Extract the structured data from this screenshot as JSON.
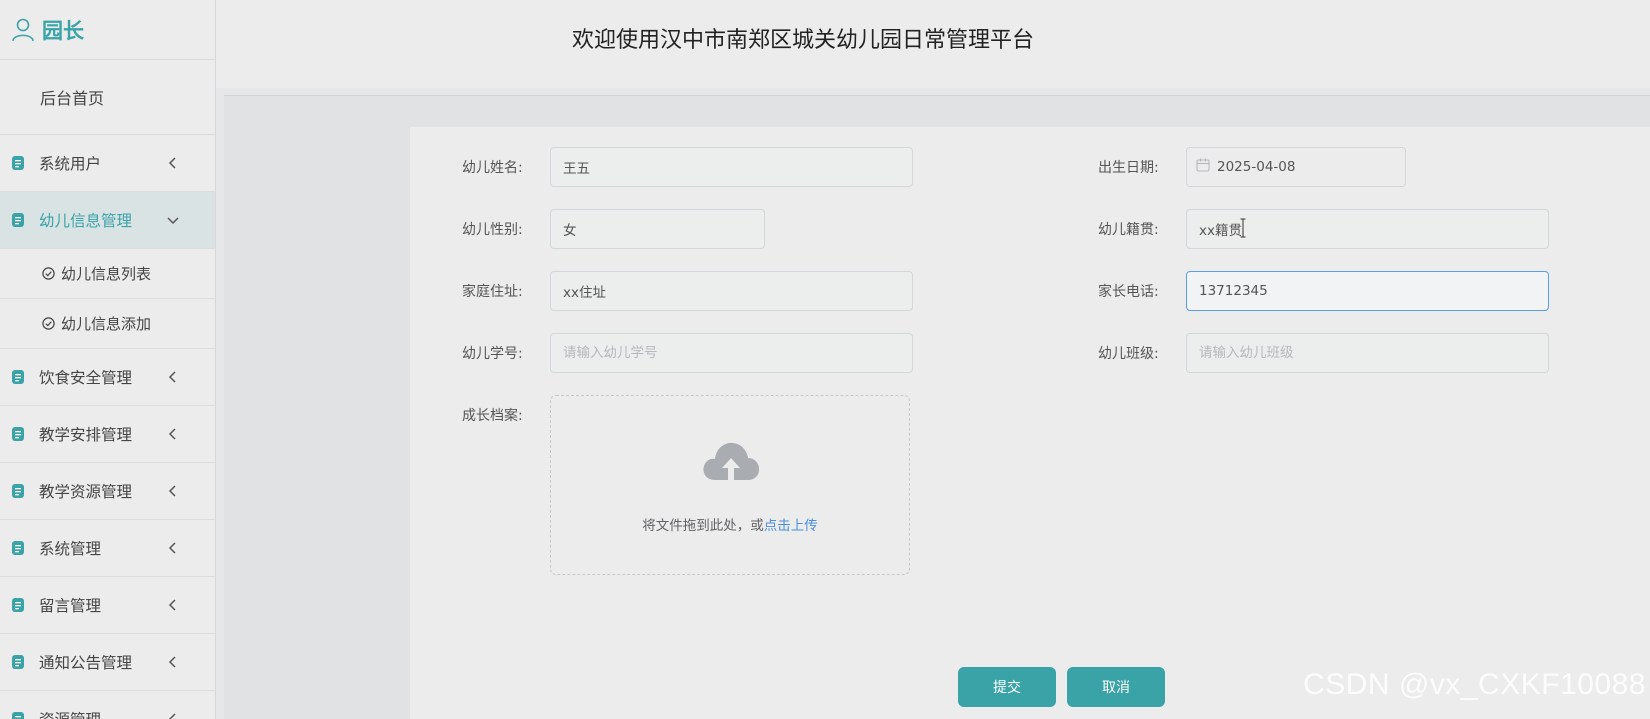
{
  "sidebar": {
    "role": "园长",
    "home": "后台首页",
    "items": [
      {
        "label": "系统用户",
        "expanded": false
      },
      {
        "label": "幼儿信息管理",
        "expanded": true,
        "children": [
          "幼儿信息列表",
          "幼儿信息添加"
        ]
      },
      {
        "label": "饮食安全管理",
        "expanded": false
      },
      {
        "label": "教学安排管理",
        "expanded": false
      },
      {
        "label": "教学资源管理",
        "expanded": false
      },
      {
        "label": "系统管理",
        "expanded": false
      },
      {
        "label": "留言管理",
        "expanded": false
      },
      {
        "label": "通知公告管理",
        "expanded": false
      },
      {
        "label": "资源管理",
        "expanded": false
      }
    ]
  },
  "header": {
    "title": "欢迎使用汉中市南郑区城关幼儿园日常管理平台"
  },
  "form": {
    "name": {
      "label": "幼儿姓名:",
      "value": "王五"
    },
    "birth": {
      "label": "出生日期:",
      "value": "2025-04-08"
    },
    "gender": {
      "label": "幼儿性别:",
      "value": "女"
    },
    "native": {
      "label": "幼儿籍贯:",
      "value": "xx籍贯"
    },
    "address": {
      "label": "家庭住址:",
      "value": "xx住址"
    },
    "phone": {
      "label": "家长电话:",
      "value": "13712345"
    },
    "student_no": {
      "label": "幼儿学号:",
      "value": "",
      "placeholder": "请输入幼儿学号"
    },
    "class": {
      "label": "幼儿班级:",
      "value": "",
      "placeholder": "请输入幼儿班级"
    },
    "archive": {
      "label": "成长档案:",
      "hint_text": "将文件拖到此处，或",
      "hint_link": "点击上传"
    },
    "submit_label": "提交",
    "cancel_label": "取消"
  },
  "watermark": "CSDN @vx_CXKF10088",
  "colors": {
    "accent": "#3aa3a8",
    "link": "#4b8fdc",
    "focus_border": "#5b9ee6"
  }
}
